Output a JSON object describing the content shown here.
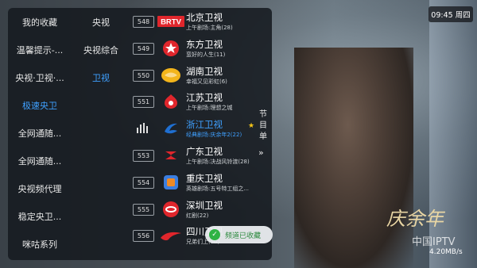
{
  "clock": "09:45 周四",
  "groups": [
    {
      "label": "我的收藏",
      "active": false
    },
    {
      "label": "温馨提示-...",
      "active": false
    },
    {
      "label": "央视·卫视·...",
      "active": false
    },
    {
      "label": "极速央卫",
      "active": true
    },
    {
      "label": "全网通随...",
      "active": false
    },
    {
      "label": "全网通随...",
      "active": false
    },
    {
      "label": "央视频代理",
      "active": false
    },
    {
      "label": "稳定央卫...",
      "active": false
    },
    {
      "label": "咪咕系列",
      "active": false
    }
  ],
  "subgroups": [
    {
      "label": "央视",
      "active": false
    },
    {
      "label": "央视综合",
      "active": false
    },
    {
      "label": "卫视",
      "active": true
    }
  ],
  "channels": [
    {
      "number": "548",
      "name": "北京卫视",
      "program": "上午剧场:主角(28)",
      "logo": "BRTV",
      "logo_color": "#e0262c",
      "active": false
    },
    {
      "number": "549",
      "name": "东方卫视",
      "program": "蛮好的人生(11)",
      "logo": "dragon",
      "logo_color": "#e0262c",
      "active": false
    },
    {
      "number": "550",
      "name": "湖南卫视",
      "program": "幸福又见彩虹(6)",
      "logo": "mango",
      "logo_color": "#f3b51b",
      "active": false
    },
    {
      "number": "551",
      "name": "江苏卫视",
      "program": "上午剧场:理想之城",
      "logo": "jiangsu",
      "logo_color": "#e0262c",
      "active": false
    },
    {
      "number": "",
      "name": "浙江卫视",
      "program": "经典剧场:庆余年2(22)",
      "logo": "zhejiang",
      "logo_color": "#1f6fd1",
      "active": true,
      "favorite": true
    },
    {
      "number": "553",
      "name": "广东卫视",
      "program": "上午剧场:决战风铃渡(28)",
      "logo": "guangdong",
      "logo_color": "#e0262c",
      "active": false
    },
    {
      "number": "554",
      "name": "重庆卫视",
      "program": "英雄剧场:五号特工组之...",
      "logo": "chongqing",
      "logo_color": "#3b7ee0",
      "active": false
    },
    {
      "number": "555",
      "name": "深圳卫视",
      "program": "红剧(22)",
      "logo": "shenzhen",
      "logo_color": "#e0262c",
      "active": false
    },
    {
      "number": "556",
      "name": "四川卫视",
      "program": "兄弟们上(30)",
      "logo": "sichuan",
      "logo_color": "#e0262c",
      "active": false
    }
  ],
  "guide_label": "节目单",
  "guide_arrow": "»",
  "favorite_star": "★",
  "toast": "频道已收藏",
  "watermark_title": "庆余年",
  "brand": "中国IPTV",
  "speed": "4.20MB/s"
}
